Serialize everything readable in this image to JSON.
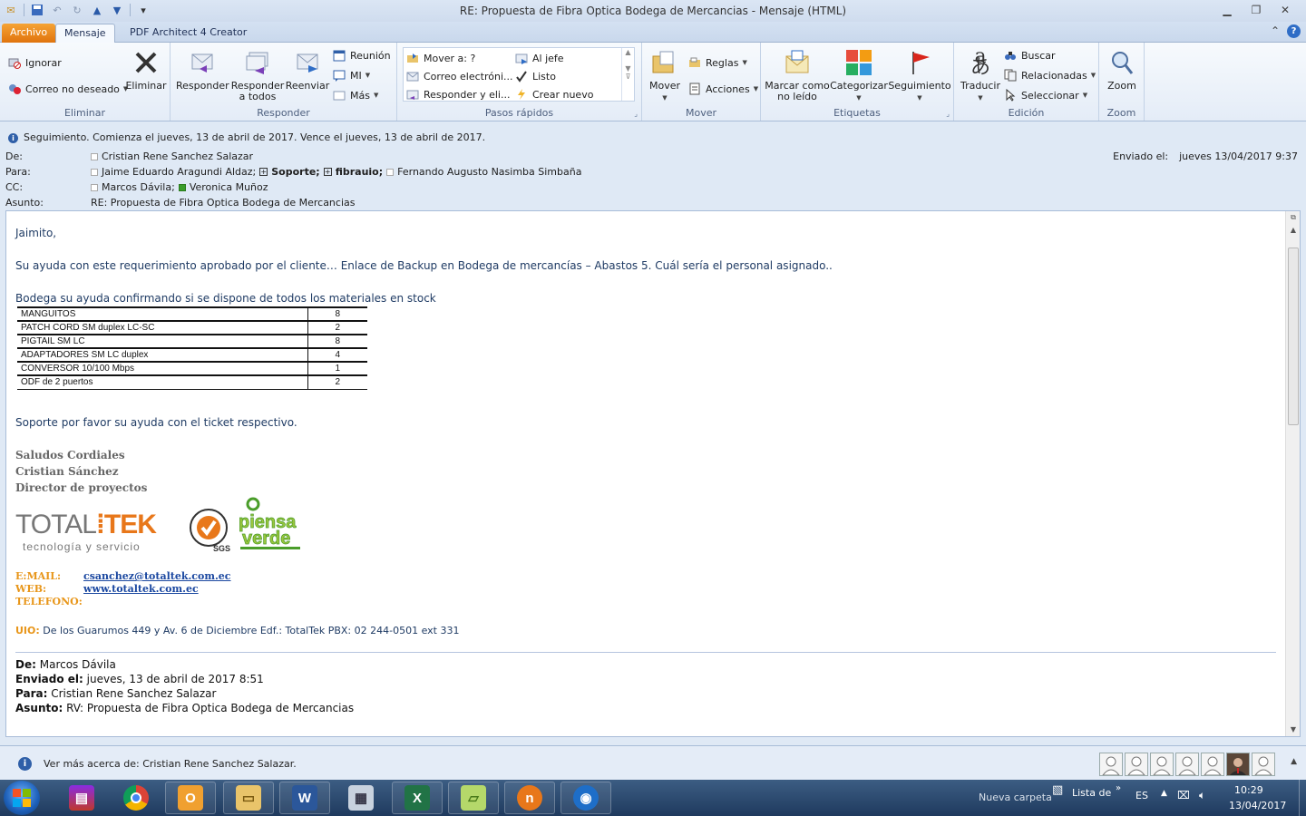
{
  "window": {
    "title": "RE: Propuesta de Fibra Optica Bodega de Mercancias  -  Mensaje (HTML)"
  },
  "tabs": {
    "file": "Archivo",
    "message": "Mensaje",
    "pdf": "PDF Architect 4 Creator"
  },
  "ribbon": {
    "eliminar": {
      "ignore": "Ignorar",
      "junk": "Correo no deseado",
      "delete": "Eliminar",
      "label": "Eliminar"
    },
    "responder": {
      "reply": "Responder",
      "reply_all_1": "Responder",
      "reply_all_2": "a todos",
      "forward": "Reenviar",
      "meeting": "Reunión",
      "im": "MI",
      "more": "Más",
      "label": "Responder"
    },
    "pasos": {
      "move_to": "Mover a: ?",
      "email": "Correo electróni...",
      "reply_del": "Responder y eli...",
      "boss": "Al jefe",
      "done": "Listo",
      "create": "Crear nuevo",
      "label": "Pasos rápidos"
    },
    "mover": {
      "move": "Mover",
      "rules": "Reglas",
      "actions": "Acciones",
      "label": "Mover"
    },
    "etiquetas": {
      "mark_1": "Marcar como",
      "mark_2": "no leído",
      "categorize": "Categorizar",
      "followup": "Seguimiento",
      "label": "Etiquetas"
    },
    "edicion": {
      "translate": "Traducir",
      "find": "Buscar",
      "related": "Relacionadas",
      "select": "Seleccionar",
      "label": "Edición"
    },
    "zoom": {
      "zoom": "Zoom",
      "label": "Zoom"
    }
  },
  "info": "Seguimiento.  Comienza el jueves, 13 de abril de 2017.  Vence el jueves, 13 de abril de 2017.",
  "header": {
    "from_label": "De:",
    "from": "Cristian Rene Sanchez Salazar",
    "to_label": "Para:",
    "to_1": "Jaime Eduardo Aragundi Aldaz;",
    "to_2": "Soporte;",
    "to_3": "fibrauio;",
    "to_4": "Fernando Augusto Nasimba Simbaña",
    "cc_label": "CC:",
    "cc_1": "Marcos Dávila;",
    "cc_2": "Veronica Muñoz",
    "subject_label": "Asunto:",
    "subject": "RE: Propuesta de Fibra Optica Bodega de Mercancias",
    "sent_label": "Enviado el:",
    "sent": "jueves 13/04/2017 9:37"
  },
  "body": {
    "greeting": "Jaimito,",
    "line1": "Su ayuda con este requerimiento aprobado por el cliente… Enlace de Backup en Bodega de mercancías – Abastos 5. Cuál sería el personal asignado..",
    "line2": "Bodega su ayuda confirmando si se dispone de todos los materiales en stock",
    "materials": [
      {
        "item": "MANGUITOS",
        "qty": "8"
      },
      {
        "item": "PATCH CORD SM duplex LC-SC",
        "qty": "2"
      },
      {
        "item": "PIGTAIL SM LC",
        "qty": "8"
      },
      {
        "item": "ADAPTADORES SM LC duplex",
        "qty": "4"
      },
      {
        "item": "CONVERSOR 10/100 Mbps",
        "qty": "1"
      },
      {
        "item": "ODF de 2 puertos",
        "qty": "2"
      }
    ],
    "line3": "Soporte por favor su ayuda con el ticket respectivo.",
    "sig1": "Saludos Cordiales",
    "sig2": "Cristian Sánchez",
    "sig3": "Director de proyectos",
    "logo_sub": "tecnología y servicio",
    "email_label": "E:MAIL:",
    "email": "csanchez@totaltek.com.ec",
    "web_label": "WEB:",
    "web": "www.totaltek.com.ec",
    "phone_label": "TELEFONO:",
    "uio_label": "UIO:",
    "uio": "De los Guarumos 449 y Av. 6 de Diciembre Edf.: TotalTek  PBX: 02 244-0501 ext 331",
    "fwd_from_label": "De:",
    "fwd_from": "Marcos Dávila",
    "fwd_sent_label": "Enviado el:",
    "fwd_sent": "jueves, 13 de abril de 2017 8:51",
    "fwd_to_label": "Para:",
    "fwd_to": "Cristian Rene Sanchez Salazar",
    "fwd_subject_label": "Asunto:",
    "fwd_subject": "RV: Propuesta de Fibra Optica Bodega de Mercancias"
  },
  "people": {
    "text": "Ver más acerca de: Cristian Rene Sanchez Salazar."
  },
  "taskbar": {
    "folder": "Nueva carpeta",
    "list": "Lista de",
    "lang": "ES",
    "time": "10:29",
    "date": "13/04/2017"
  },
  "colors": {
    "accent_orange": "#e8771a",
    "body_blue": "#1f3b64",
    "link_blue": "#1a47a0",
    "file_tab": "#e0740e"
  }
}
